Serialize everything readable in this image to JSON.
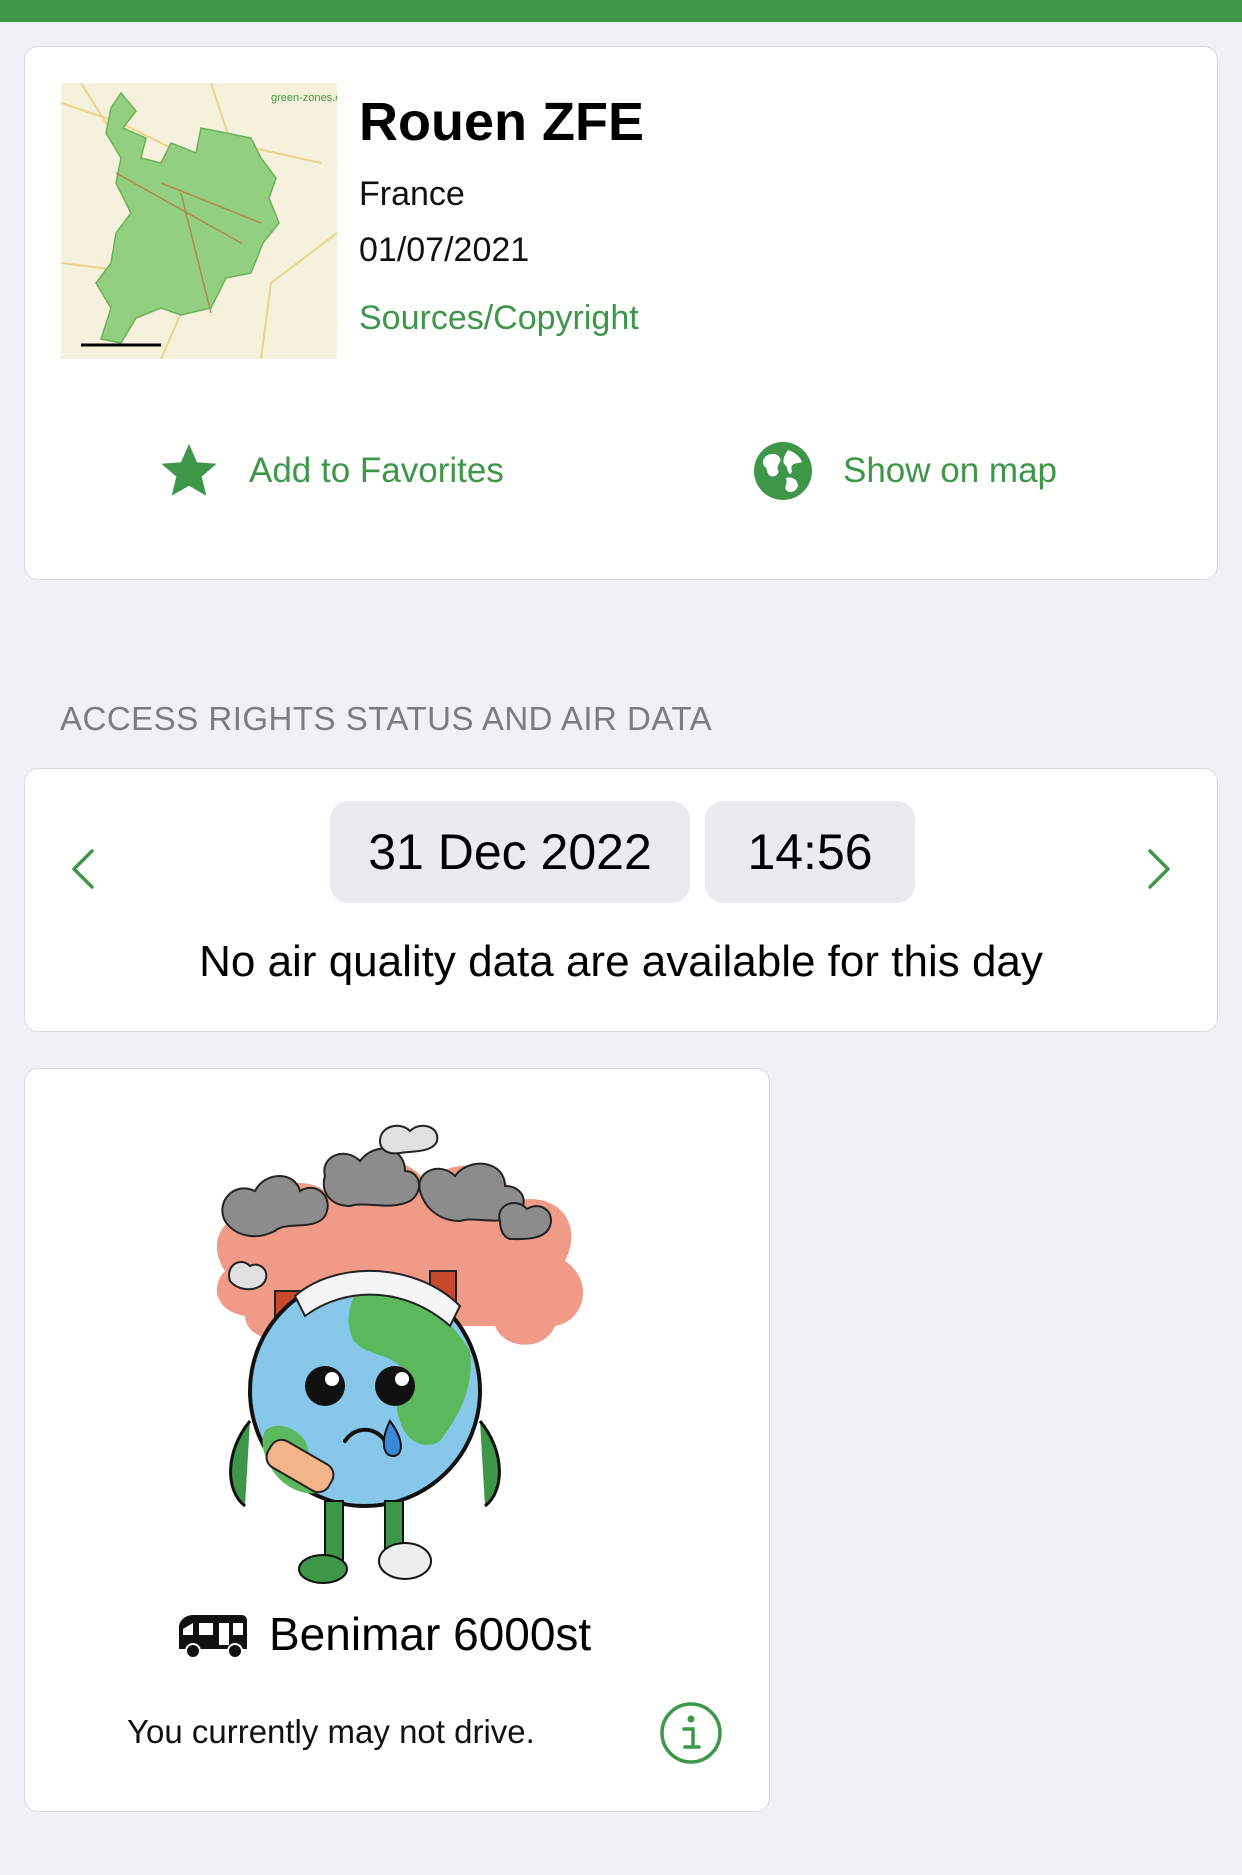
{
  "zone": {
    "title": "Rouen ZFE",
    "country": "France",
    "date": "01/07/2021",
    "sources_label": "Sources/Copyright",
    "thumbnail_brand": "green-zones.eu"
  },
  "actions": {
    "favorite_label": "Add to Favorites",
    "favorite_icon": "star-icon",
    "map_label": "Show on map",
    "map_icon": "globe-icon"
  },
  "section": {
    "header": "ACCESS RIGHTS STATUS AND AIR DATA"
  },
  "datetime": {
    "date": "31 Dec 2022",
    "time": "14:56",
    "air_message": "No air quality data are available for this day"
  },
  "status": {
    "vehicle_name": "Benimar 6000st",
    "vehicle_icon": "camper-van-icon",
    "message": "You currently may not drive.",
    "mascot": "sick-earth-illustration"
  },
  "colors": {
    "accent": "#3e9648",
    "background": "#f0f0f5",
    "card": "#ffffff",
    "pill": "#ebebef",
    "muted_text": "#7b7b80"
  }
}
